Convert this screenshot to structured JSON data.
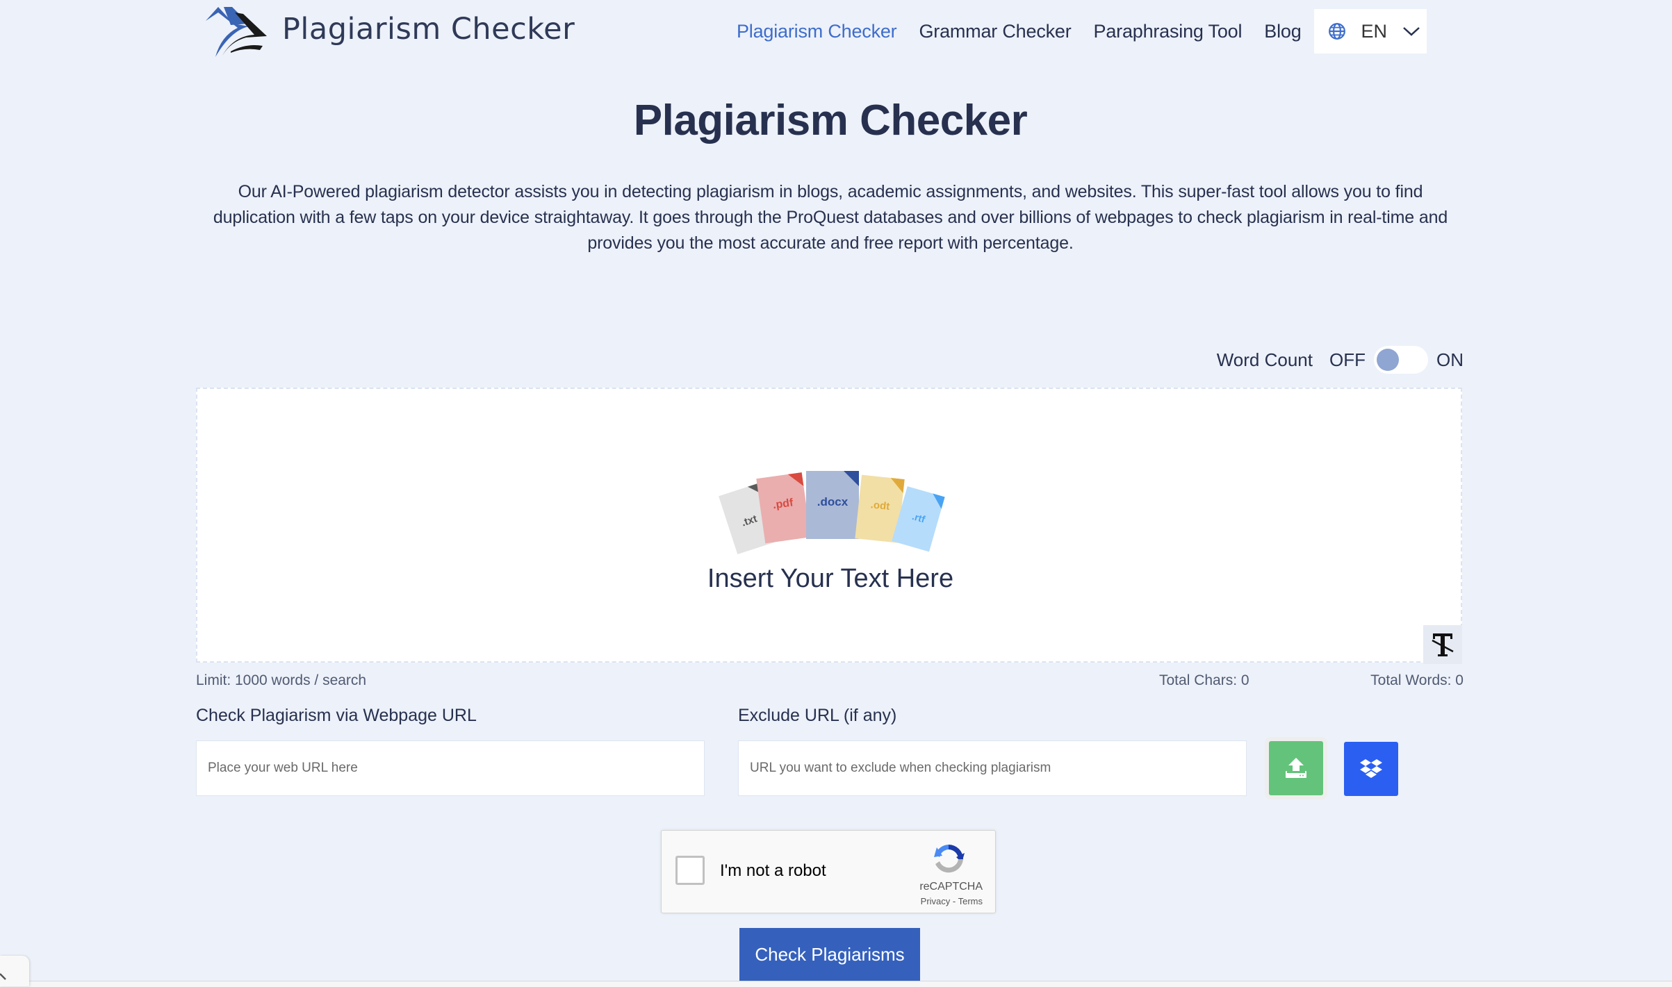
{
  "header": {
    "logo_text": "Plagiarism Checker",
    "nav": [
      {
        "label": "Plagiarism Checker",
        "active": true
      },
      {
        "label": "Grammar Checker",
        "active": false
      },
      {
        "label": "Paraphrasing Tool",
        "active": false
      },
      {
        "label": "Blog",
        "active": false
      }
    ],
    "language": {
      "icon": "globe-icon",
      "code": "EN",
      "dropdown_icon": "chevron-down-icon"
    }
  },
  "hero": {
    "title": "Plagiarism Checker",
    "description": "Our AI-Powered plagiarism detector assists you in detecting plagiarism in blogs, academic assignments, and websites. This super-fast tool allows you to find duplication with a few taps on your device straightaway. It goes through the ProQuest databases and over billions of webpages to check plagiarism in real-time and provides you the most accurate and free report with percentage."
  },
  "word_count": {
    "label": "Word Count",
    "off": "OFF",
    "on": "ON",
    "enabled": false
  },
  "editor": {
    "prompt": "Insert Your Text Here",
    "file_types": [
      ".txt",
      ".pdf",
      ".docx",
      ".odt",
      ".rtf"
    ],
    "clear_format_icon": "clear-format-icon"
  },
  "stats": {
    "limit": "Limit: 1000 words / search",
    "total_chars": "Total Chars: 0",
    "total_words": "Total Words: 0"
  },
  "url_check": {
    "label": "Check Plagiarism via Webpage URL",
    "placeholder": "Place your web URL here",
    "value": ""
  },
  "exclude_url": {
    "label": "Exclude URL (if any)",
    "placeholder": "URL you want to exclude when checking plagiarism",
    "value": ""
  },
  "upload": {
    "icon": "upload-icon",
    "color": "#64c37a"
  },
  "dropbox": {
    "icon": "dropbox-icon",
    "color": "#2a5ff2"
  },
  "recaptcha": {
    "label": "I'm not a robot",
    "brand": "reCAPTCHA",
    "links": "Privacy - Terms",
    "checked": false
  },
  "submit": {
    "label": "Check Plagiarisms",
    "color": "#3561bd"
  },
  "colors": {
    "accent": "#3d6dcc",
    "background": "#edf1f9",
    "text": "#27314f"
  }
}
